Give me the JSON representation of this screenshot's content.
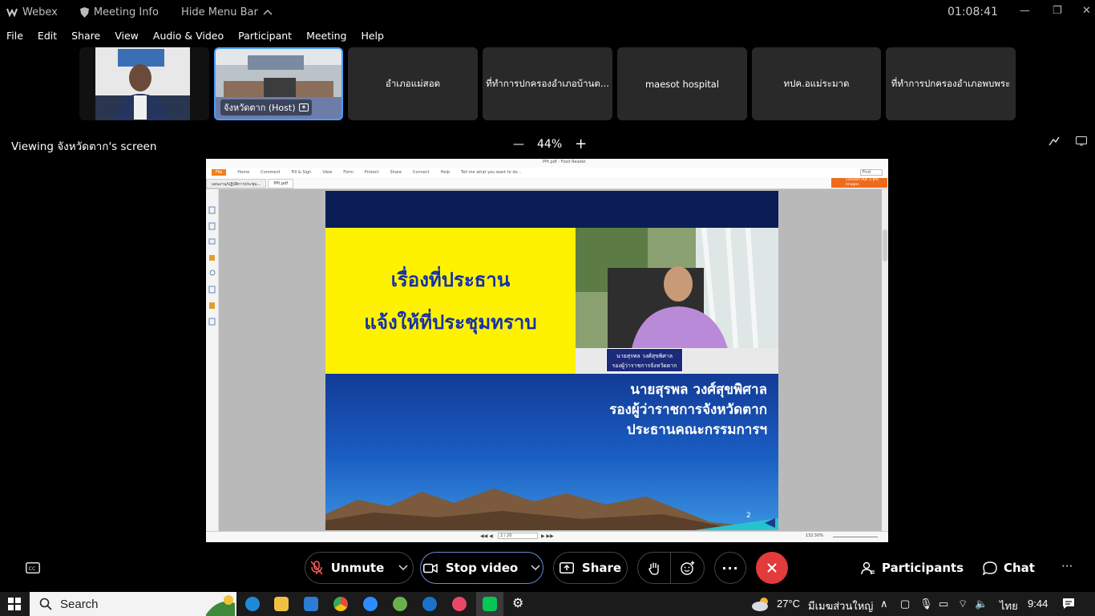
{
  "titlebar": {
    "app_name": "Webex",
    "meeting_info": "Meeting Info",
    "hide_menu_bar": "Hide Menu Bar",
    "timer": "01:08:41"
  },
  "menu": [
    "File",
    "Edit",
    "Share",
    "View",
    "Audio & Video",
    "Participant",
    "Meeting",
    "Help"
  ],
  "participants": [
    {
      "name": ""
    },
    {
      "name": "จังหวัดตาก (Host)"
    },
    {
      "name": "อำเภอแม่สอด"
    },
    {
      "name": "ที่ทำการปกครองอำเภอบ้านต..."
    },
    {
      "name": "maesot hospital"
    },
    {
      "name": "ทปค.อแม่ระมาด"
    },
    {
      "name": "ที่ทำการปกครองอำเภอพบพระ"
    }
  ],
  "viewing": {
    "label": "Viewing จังหวัดตาก's screen",
    "zoom": "44%"
  },
  "pdf": {
    "title": "PPt.pdf - Foxit Reader",
    "ribbon": [
      "File",
      "Home",
      "Comment",
      "Fill & Sign",
      "View",
      "Form",
      "Protect",
      "Share",
      "Connect",
      "Help",
      "Tell me what you want to do..."
    ],
    "tabs": [
      "แผนงาน/ปฏิบัติการประชุม...",
      "PPt.pdf"
    ],
    "find_placeholder": "Find",
    "convert_badge": "Convert PDF 2 JPG Images",
    "page_indicator": "2 / 20",
    "zoom": "132.50%"
  },
  "slide": {
    "heading_line1": "เรื่องที่ประธาน",
    "heading_line2": "แจ้งให้ที่ประชุมทราบ",
    "nameplate_line1": "นายสุรพล วงศ์สุขพิศาล",
    "nameplate_line2": "รองผู้ว่าราชการจังหวัดตาก",
    "name_line1": "นายสุรพล  วงศ์สุขพิศาล",
    "name_line2": "รองผู้ว่าราชการจังหวัดตาก",
    "name_line3": "ประธานคณะกรรมการฯ",
    "page_number": "2"
  },
  "controls": {
    "unmute": "Unmute",
    "stop_video": "Stop video",
    "share": "Share",
    "participants": "Participants",
    "chat": "Chat"
  },
  "taskbar": {
    "search": "Search",
    "weather_temp": "27°C",
    "weather_text": "มีเมฆส่วนใหญ่",
    "language": "ไทย",
    "clock": "9:44"
  },
  "colors": {
    "end_button": "#e33b3b",
    "host_border": "#4a9dff",
    "slide_yellow": "#fff200",
    "slide_heading": "#1531a8"
  }
}
